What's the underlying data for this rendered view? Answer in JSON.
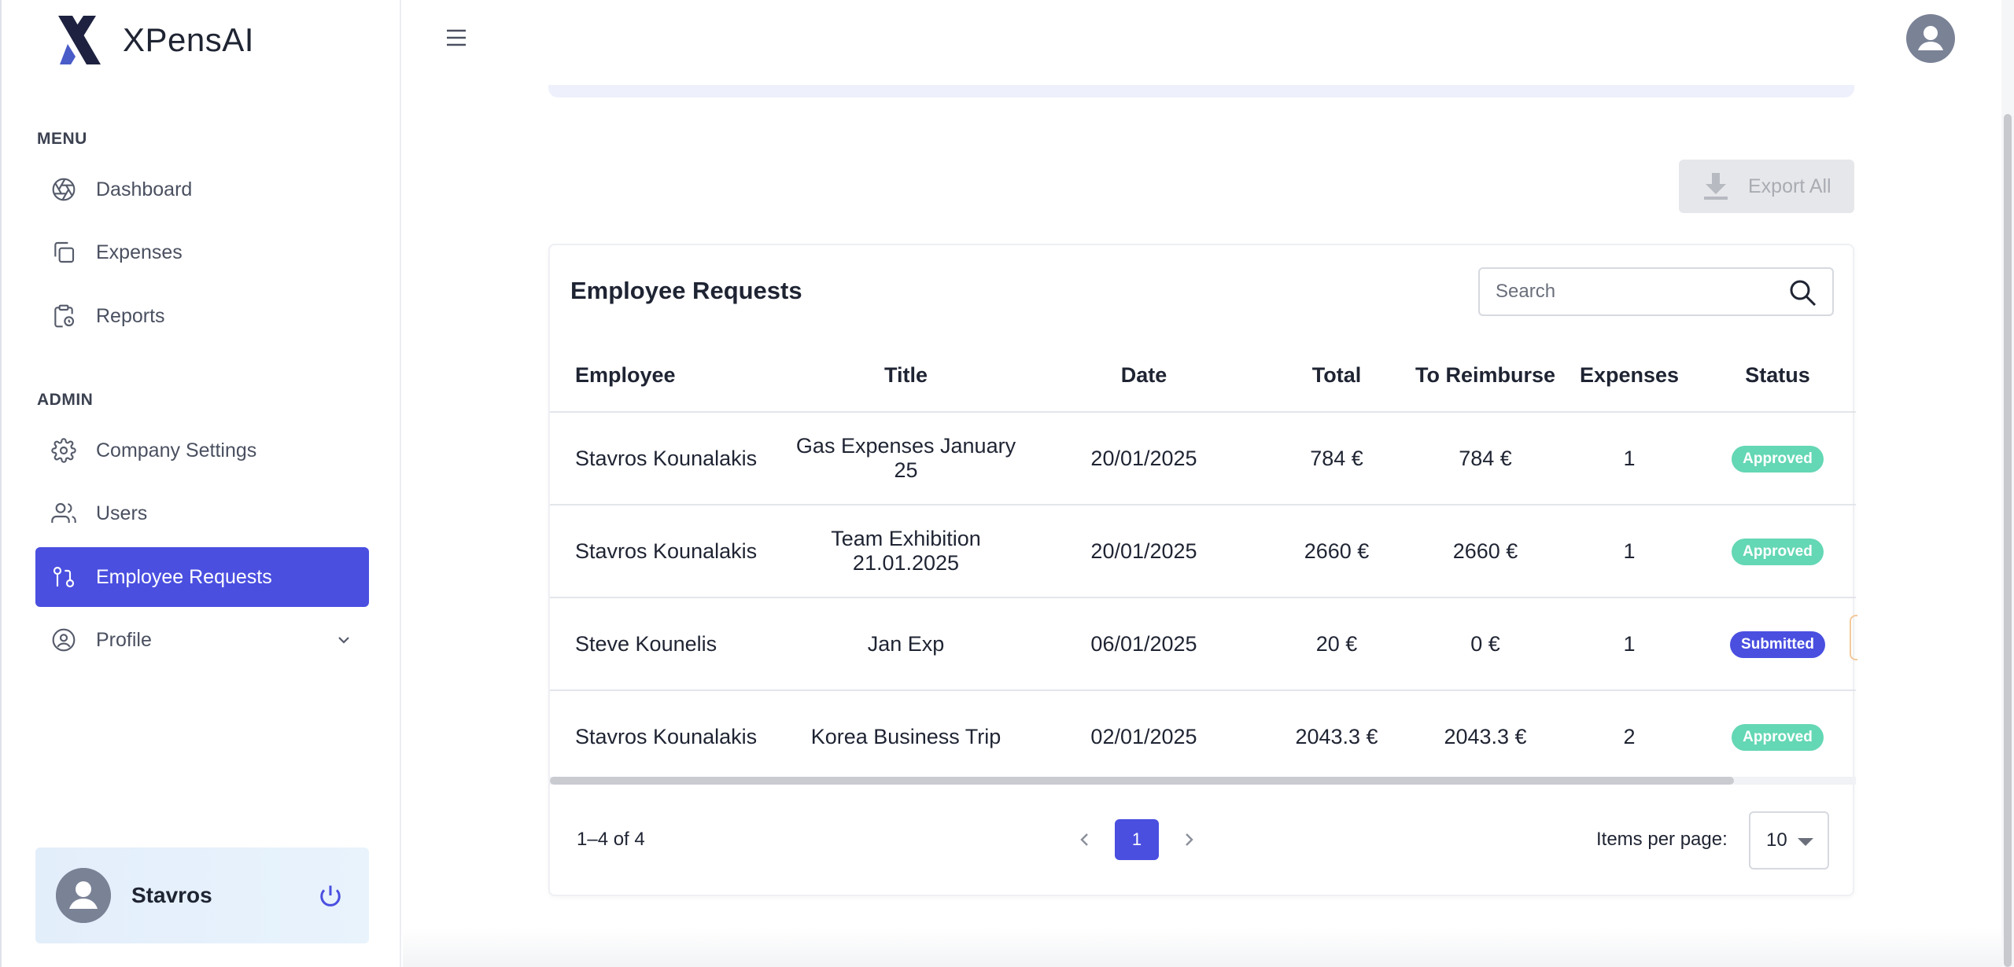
{
  "app": {
    "name": "XPensAI",
    "accent_color": "#4a4fe0"
  },
  "sidebar": {
    "menu_label": "MENU",
    "admin_label": "ADMIN",
    "menu_items": [
      {
        "label": "Dashboard",
        "icon": "aperture-icon"
      },
      {
        "label": "Expenses",
        "icon": "copy-icon"
      },
      {
        "label": "Reports",
        "icon": "clipboard-clock-icon"
      }
    ],
    "admin_items": [
      {
        "label": "Company Settings",
        "icon": "gear-icon"
      },
      {
        "label": "Users",
        "icon": "users-icon"
      },
      {
        "label": "Employee Requests",
        "icon": "git-pull-request-icon",
        "active": true
      },
      {
        "label": "Profile",
        "icon": "user-circle-icon"
      }
    ],
    "user": {
      "name": "Stavros"
    }
  },
  "toolbar": {
    "export_label": "Export All"
  },
  "requests": {
    "title": "Employee Requests",
    "search_placeholder": "Search",
    "columns": [
      "Employee",
      "Title",
      "Date",
      "Total",
      "To Reimburse",
      "Expenses",
      "Status"
    ],
    "rows": [
      {
        "employee": "Stavros Kounalakis",
        "title": "Gas Expenses January 25",
        "date": "20/01/2025",
        "total": "784 €",
        "reimburse": "784 €",
        "expenses": "1",
        "status": "Approved"
      },
      {
        "employee": "Stavros Kounalakis",
        "title": "Team Exhibition 21.01.2025",
        "date": "20/01/2025",
        "total": "2660 €",
        "reimburse": "2660 €",
        "expenses": "1",
        "status": "Approved"
      },
      {
        "employee": "Steve Kounelis",
        "title": "Jan Exp",
        "date": "06/01/2025",
        "total": "20 €",
        "reimburse": "0 €",
        "expenses": "1",
        "status": "Submitted"
      },
      {
        "employee": "Stavros Kounalakis",
        "title": "Korea Business Trip",
        "date": "02/01/2025",
        "total": "2043.3 €",
        "reimburse": "2043.3 €",
        "expenses": "2",
        "status": "Approved"
      }
    ],
    "status_colors": {
      "Approved": "#64d7b4",
      "Submitted": "#4a4fe0"
    }
  },
  "pagination": {
    "range": "1–4 of 4",
    "current_page": "1",
    "items_per_page_label": "Items per page:",
    "items_per_page": "10"
  }
}
